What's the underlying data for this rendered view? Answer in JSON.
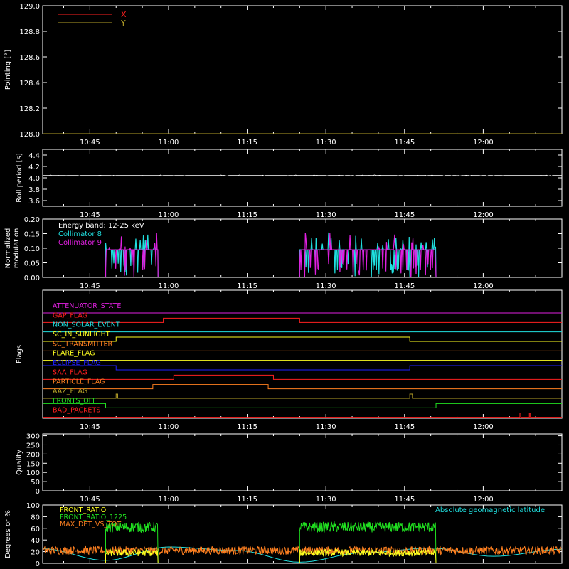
{
  "x_axis": {
    "start_minute": 636,
    "end_minute": 735,
    "tick_minutes": [
      645,
      660,
      675,
      690,
      705,
      720
    ],
    "tick_labels": [
      "10:45",
      "11:00",
      "11:15",
      "11:30",
      "11:45",
      "12:00"
    ]
  },
  "colors": {
    "background": "#000000",
    "axis": "#ffffff",
    "red": "#ff2020",
    "olive": "#b4a028",
    "cyan": "#20e0e0",
    "magenta": "#e020e0",
    "green": "#20e020",
    "orange": "#ff8020",
    "yellow": "#ffff20",
    "blue": "#2020ff"
  },
  "chart_data": [
    {
      "id": "pointing",
      "type": "line",
      "ylabel": "Pointing [°]",
      "ylim": [
        128.0,
        129.0
      ],
      "yticks": [
        128.0,
        128.2,
        128.4,
        128.6,
        128.8,
        129.0
      ],
      "ytick_labels": [
        "128.0",
        "128.2",
        "128.4",
        "128.6",
        "128.8",
        "129.0"
      ],
      "legend_position": "top-left",
      "series": [
        {
          "name": "X",
          "color": "#ff2020",
          "x": [
            636,
            735
          ],
          "y": [
            128.0,
            128.0
          ]
        },
        {
          "name": "Y",
          "color": "#b4a028",
          "x": [
            636,
            735
          ],
          "y": [
            128.0,
            128.0
          ]
        }
      ]
    },
    {
      "id": "roll",
      "type": "line",
      "ylabel": "Roll period [s]",
      "ylim": [
        3.5,
        4.5
      ],
      "yticks": [
        3.6,
        3.8,
        4.0,
        4.2,
        4.4
      ],
      "ytick_labels": [
        "3.6",
        "3.8",
        "4.0",
        "4.2",
        "4.4"
      ],
      "series": [
        {
          "color": "#ffffff",
          "x": [
            636,
            735
          ],
          "y": [
            4.04,
            4.04
          ],
          "jitter": 0.01
        }
      ]
    },
    {
      "id": "modulation",
      "type": "line",
      "ylabel": [
        "Normalized",
        "modulation"
      ],
      "ylim": [
        0.0,
        0.2
      ],
      "yticks": [
        0.0,
        0.05,
        0.1,
        0.15,
        0.2
      ],
      "ytick_labels": [
        "0.00",
        "0.05",
        "0.10",
        "0.15",
        "0.20"
      ],
      "annotation": "Energy band: 12-25 keV",
      "legend_position": "top-left",
      "series": [
        {
          "name": "Collimator 8",
          "color": "#20e0e0",
          "segments": [
            [
              648,
              658
            ],
            [
              685,
              711
            ]
          ],
          "level": 0.095,
          "noise": 0.06
        },
        {
          "name": "Collimator 9",
          "color": "#e020e0",
          "segments": [
            [
              648,
              658
            ],
            [
              685,
              711
            ]
          ],
          "level": 0.095,
          "noise": 0.06
        }
      ]
    },
    {
      "id": "flags",
      "type": "line",
      "ylabel": "Flags",
      "flags": [
        {
          "name": "ATTENUATOR_STATE",
          "color": "#e020e0",
          "high": []
        },
        {
          "name": "GAP_FLAG",
          "color": "#ff2020",
          "high": [
            [
              659,
              685
            ]
          ]
        },
        {
          "name": "NON_SOLAR_EVENT",
          "color": "#20e0e0",
          "high": []
        },
        {
          "name": "SC_IN_SUNLIGHT",
          "color": "#ffff20",
          "high": [
            [
              650,
              706
            ]
          ]
        },
        {
          "name": "SC_TRANSMITTER",
          "color": "#ff8020",
          "high": []
        },
        {
          "name": "FLARE_FLAG",
          "color": "#ffff20",
          "high": []
        },
        {
          "name": "ECLIPSE_FLAG",
          "color": "#2020ff",
          "high": [
            [
              636,
              650
            ],
            [
              706,
              735
            ]
          ]
        },
        {
          "name": "SAA_FLAG",
          "color": "#ff2020",
          "high": [
            [
              661,
              680
            ]
          ]
        },
        {
          "name": "PARTICLE_FLAG",
          "color": "#ff8020",
          "high": [
            [
              657,
              679
            ]
          ]
        },
        {
          "name": "AAZ_FLAG",
          "color": "#b4a028",
          "high": [
            [
              650,
              650.3
            ],
            [
              706,
              706.5
            ]
          ]
        },
        {
          "name": "FRONTS_OFF",
          "color": "#20e020",
          "high": [
            [
              636,
              648
            ],
            [
              711,
              735
            ]
          ]
        },
        {
          "name": "BAD_PACKETS",
          "color": "#ff2020",
          "high": [
            [
              727,
              727.2
            ],
            [
              728.8,
              729
            ]
          ]
        }
      ]
    },
    {
      "id": "quality",
      "type": "line",
      "ylabel": "Quality",
      "ylim": [
        0,
        310
      ],
      "yticks": [
        0,
        50,
        100,
        150,
        200,
        250,
        300
      ],
      "ytick_labels": [
        "0",
        "50",
        "100",
        "150",
        "200",
        "250",
        "300"
      ],
      "series": []
    },
    {
      "id": "ratios",
      "type": "line",
      "ylabel": "Degrees or %",
      "ylim": [
        0,
        100
      ],
      "yticks": [
        0,
        20,
        40,
        60,
        80,
        100
      ],
      "ytick_labels": [
        "0",
        "20",
        "40",
        "60",
        "80",
        "100"
      ],
      "right_annotation": "Absolute geomagnetic latitude",
      "series": [
        {
          "name": "FRONT_RATIO",
          "color": "#ffff20",
          "segments": [
            [
              648,
              658
            ],
            [
              685,
              711
            ]
          ],
          "level": 18,
          "noise": 6
        },
        {
          "name": "FRONT_RATIO_1225",
          "color": "#20e020",
          "segments": [
            [
              648,
              658
            ],
            [
              685,
              711
            ]
          ],
          "level": 62,
          "noise": 9
        },
        {
          "name": "MAX_DET_VS_TOT",
          "color": "#ff8020",
          "x": [
            636,
            735
          ],
          "level": 22,
          "noise": 7
        },
        {
          "name": "Absolute geomagnetic latitude",
          "color": "#20e0e0",
          "x": [
            636,
            648,
            660,
            673,
            685,
            697,
            710,
            722,
            735
          ],
          "y": [
            25,
            5,
            28,
            22,
            2,
            18,
            26,
            12,
            24
          ]
        }
      ]
    }
  ]
}
